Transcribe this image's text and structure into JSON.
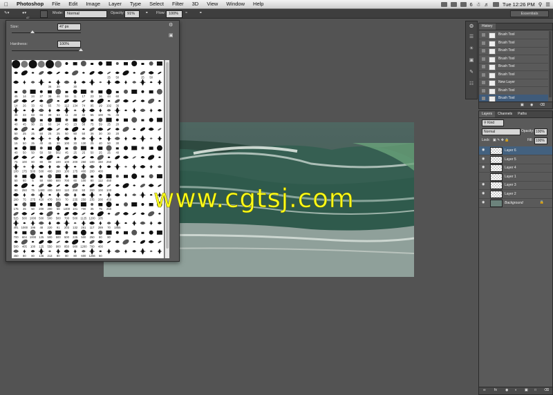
{
  "menubar": {
    "app": "Photoshop",
    "items": [
      "File",
      "Edit",
      "Image",
      "Layer",
      "Type",
      "Select",
      "Filter",
      "3D",
      "View",
      "Window",
      "Help"
    ],
    "clock": "Tue 12:26 PM",
    "battery_num": "6"
  },
  "options": {
    "size_small": "47",
    "mode_label": "Mode:",
    "mode_value": "Normal",
    "opacity_label": "Opacity:",
    "opacity_value": "91%",
    "flow_label": "Flow:",
    "flow_value": "100%",
    "workspace": "Essentials"
  },
  "picker": {
    "size_label": "Size:",
    "size_value": "47 px",
    "hardness_label": "Hardness:",
    "hardness_value": "100%",
    "size_fraction": 0.3,
    "hardness_fraction": 1.0,
    "brush_numbers": [
      [
        "",
        "",
        "",
        "",
        "",
        "",
        "",
        "",
        "",
        "",
        "",
        "",
        "",
        "",
        "",
        "",
        "",
        ""
      ],
      [
        "",
        "",
        "",
        "",
        "",
        "",
        "",
        "",
        "",
        "",
        "",
        "25",
        "50",
        "",
        "",
        "25",
        "50",
        ""
      ],
      [
        "",
        "",
        "",
        "",
        "36",
        "30",
        "",
        "30",
        "",
        "",
        "",
        "",
        "",
        "",
        "",
        "",
        "",
        ""
      ],
      [
        "45",
        "14",
        "24",
        "27",
        "39",
        "46",
        "59",
        "11",
        "17",
        "23",
        "36",
        "44",
        "60",
        "",
        "",
        "",
        "",
        ""
      ],
      [
        "14",
        "26",
        "33",
        "42",
        "55",
        "70",
        "112",
        "134",
        "74",
        "95",
        "29",
        "192",
        "36",
        "",
        "",
        "",
        "",
        ""
      ],
      [
        "36",
        "33",
        "63",
        "66",
        "39",
        "63",
        "11",
        "48",
        "32",
        "55",
        "100",
        "75",
        "45",
        "",
        "",
        "",
        "",
        ""
      ],
      [
        "40",
        "45",
        "90",
        "21",
        "60",
        "14",
        "43",
        "23",
        "58",
        "75",
        "59",
        "25",
        "20",
        "",
        "",
        "",
        "",
        ""
      ],
      [
        "50",
        "25",
        "25",
        "50",
        "25",
        "25",
        "50",
        "50",
        "50",
        "36",
        "30",
        "30",
        "20",
        "",
        "",
        "",
        "",
        ""
      ],
      [
        "15",
        "50",
        "25",
        "40",
        "45",
        "30",
        "100",
        "30",
        "130",
        "25",
        "40",
        "50",
        "30",
        "",
        "",
        "",
        "",
        ""
      ],
      [
        "40",
        "50",
        "50",
        "50",
        "50",
        "502",
        "45",
        "25",
        "25",
        "50",
        "25",
        "25",
        "40",
        "",
        "",
        "",
        "",
        ""
      ],
      [
        "75",
        "100",
        "80",
        "80",
        "80",
        "100",
        "100",
        "200",
        "250",
        "100",
        "150",
        "250",
        "",
        "",
        "",
        "",
        "",
        ""
      ],
      [
        "100",
        "175",
        "500",
        "500",
        "400",
        "200",
        "100",
        "175",
        "400",
        "200",
        "400",
        "",
        "",
        "",
        "",
        "",
        "",
        ""
      ],
      [
        "50",
        "60",
        "5",
        "50",
        "650",
        "600",
        "700",
        "60",
        "100",
        "80",
        "112",
        "450",
        "",
        "",
        "",
        "",
        "",
        ""
      ],
      [
        "90",
        "250",
        "75",
        "1400",
        "400",
        "500",
        "110",
        "250",
        "50",
        "200",
        "100",
        "100",
        "",
        "",
        "",
        "",
        "",
        ""
      ],
      [
        "200",
        "75",
        "275",
        "420",
        "470",
        "500",
        "70",
        "235",
        "250",
        "235",
        "200",
        "450",
        "",
        "",
        "",
        "",
        "",
        ""
      ],
      [
        "175",
        "45",
        "50",
        "200",
        "200",
        "58",
        "1400",
        "101",
        "700",
        "35",
        "75",
        "250",
        "",
        "",
        "",
        "",
        "",
        ""
      ],
      [
        "525",
        "500",
        "1000",
        "500",
        "500",
        "500",
        "700",
        "500",
        "1125",
        "1200",
        "105",
        "",
        "",
        "",
        "",
        "",
        "",
        ""
      ],
      [
        "491",
        "1000",
        "196",
        "48",
        "220",
        "91",
        "203",
        "132",
        "261",
        "117",
        "289",
        "70",
        "1855",
        "",
        "",
        "",
        "",
        ""
      ],
      [
        "700",
        "604",
        "1000",
        "125",
        "500",
        "500",
        "500",
        "225",
        "500",
        "250",
        "80",
        "80",
        "",
        "",
        "",
        "",
        "",
        ""
      ],
      [
        "500",
        "405",
        "100",
        "125",
        "550",
        "900",
        "850",
        "980",
        "1200",
        "700",
        "400",
        "",
        "",
        "",
        "",
        "",
        "",
        ""
      ],
      [
        "450",
        "80",
        "80",
        "146",
        "213",
        "80",
        "80",
        "80",
        "600",
        "1266",
        "50",
        "",
        "",
        "",
        "",
        "",
        "",
        ""
      ]
    ]
  },
  "history": {
    "tab": "History",
    "rows": [
      {
        "label": "Brush Tool",
        "selected": false
      },
      {
        "label": "Brush Tool",
        "selected": false
      },
      {
        "label": "Brush Tool",
        "selected": false
      },
      {
        "label": "Brush Tool",
        "selected": false
      },
      {
        "label": "Brush Tool",
        "selected": false
      },
      {
        "label": "Brush Tool",
        "selected": false
      },
      {
        "label": "New Layer",
        "selected": false
      },
      {
        "label": "Brush Tool",
        "selected": false
      },
      {
        "label": "Brush Tool",
        "selected": true
      }
    ]
  },
  "layers": {
    "tabs": [
      "Layers",
      "Channels",
      "Paths"
    ],
    "kind": "Kind",
    "blend": "Normal",
    "opacity_label": "Opacity:",
    "opacity": "100%",
    "lock_label": "Lock:",
    "fill_label": "Fill:",
    "fill": "100%",
    "rows": [
      {
        "name": "Layer 6",
        "selected": true,
        "visible": true
      },
      {
        "name": "Layer 5",
        "selected": false,
        "visible": true
      },
      {
        "name": "Layer 4",
        "selected": false,
        "visible": true
      },
      {
        "name": "Layer 1",
        "selected": false,
        "visible": false
      },
      {
        "name": "Layer 3",
        "selected": false,
        "visible": true
      },
      {
        "name": "Layer 2",
        "selected": false,
        "visible": true
      },
      {
        "name": "Background",
        "selected": false,
        "visible": true
      }
    ]
  },
  "watermark": "www.cgtsj.com",
  "colors": {
    "panel": "#5a5a5a",
    "selection": "#3f5b7a",
    "watermark": "#ffff1a"
  }
}
